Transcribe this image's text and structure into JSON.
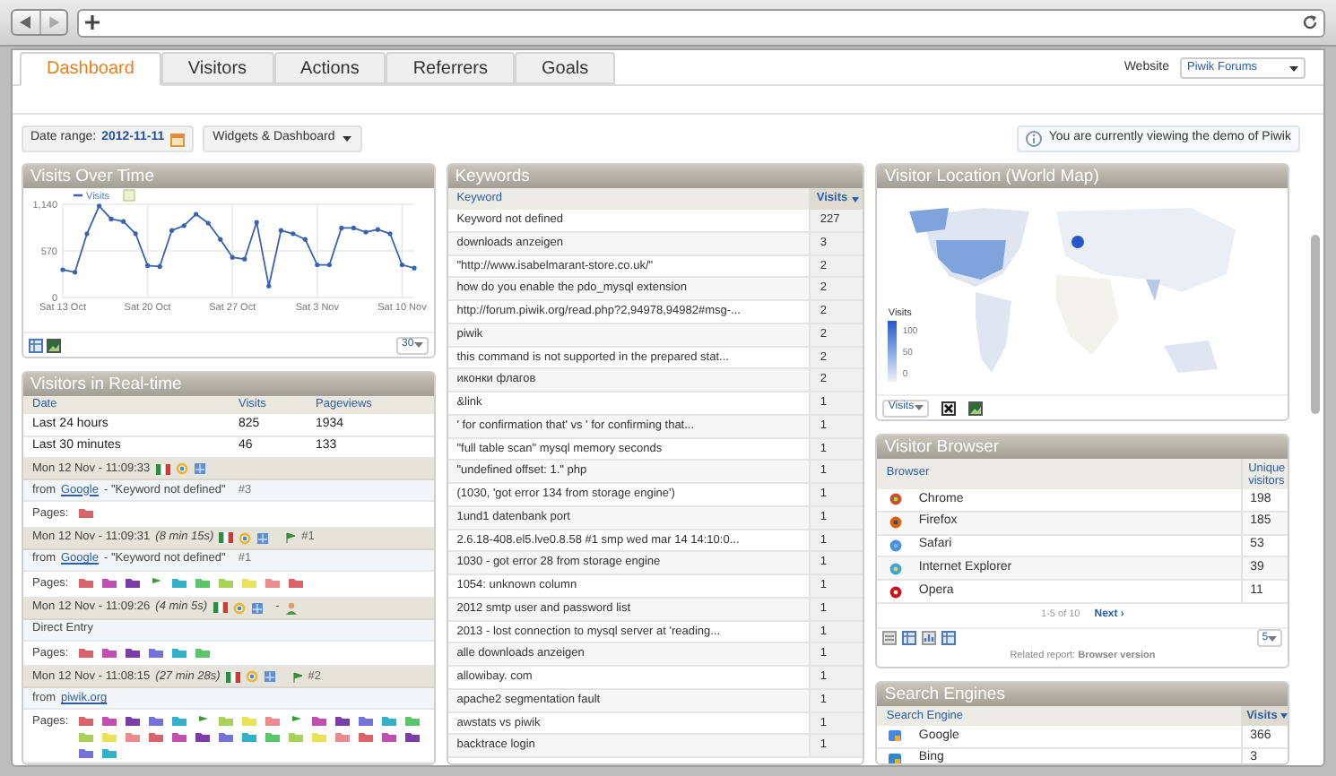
{
  "tabs": [
    {
      "label": "Dashboard",
      "selected": true
    },
    {
      "label": "Visitors",
      "selected": false
    },
    {
      "label": "Actions",
      "selected": false
    },
    {
      "label": "Referrers",
      "selected": false
    },
    {
      "label": "Goals",
      "selected": false
    }
  ],
  "website": {
    "label": "Website",
    "value": "Piwik Forums"
  },
  "toolbar": {
    "date_label": "Date range:",
    "date_value": "2012-11-11",
    "widgets_button": "Widgets & Dashboard",
    "notice": "You are currently viewing the demo of Piwik"
  },
  "visits_over_time": {
    "title": "Visits Over Time",
    "period_select": "30",
    "chart_data": {
      "type": "line",
      "ylim": [
        0,
        1140
      ],
      "grid": true,
      "categories": [
        "Sat 13 Oct",
        null,
        null,
        null,
        null,
        null,
        null,
        "Sat 20 Oct",
        null,
        null,
        null,
        null,
        null,
        null,
        "Sat 27 Oct",
        null,
        null,
        null,
        null,
        null,
        null,
        "Sat 3 Nov",
        null,
        null,
        null,
        null,
        null,
        null,
        "Sat 10 Nov",
        null
      ],
      "yticks": [
        {
          "value": 0,
          "label": "0"
        },
        {
          "value": 570,
          "label": "570"
        },
        {
          "value": 1140,
          "label": "1,140"
        }
      ],
      "series": [
        {
          "name": "Visits",
          "color": "#3a62ad",
          "values": [
            340,
            310,
            780,
            1120,
            960,
            930,
            780,
            390,
            380,
            820,
            880,
            1020,
            910,
            710,
            490,
            470,
            920,
            140,
            820,
            780,
            710,
            400,
            400,
            850,
            850,
            800,
            830,
            780,
            400,
            360
          ]
        }
      ]
    }
  },
  "realtime": {
    "title": "Visitors in Real-time",
    "columns": [
      "Date",
      "Visits",
      "Pageviews"
    ],
    "rows": [
      [
        "Last 24 hours",
        "825",
        "1934"
      ],
      [
        "Last 30 minutes",
        "46",
        "133"
      ]
    ],
    "visits": [
      {
        "time": "Mon 12 Nov - 11:09:33",
        "referrer": {
          "kind": "search",
          "prefix": "from",
          "link": "Google",
          "keyword": "- \"Keyword not defined\"",
          "rank": "#3"
        },
        "pages_label": "Pages:",
        "pages": [
          {
            "kind": "folder",
            "color": "#d9636b"
          }
        ]
      },
      {
        "time": "Mon 12 Nov - 11:09:31",
        "duration": "(8 min 15s)",
        "goals": "#1",
        "referrer": {
          "kind": "search",
          "prefix": "from",
          "link": "Google",
          "keyword": "- \"Keyword not defined\"",
          "rank": "#1"
        },
        "pages_label": "Pages:",
        "pages": [
          {
            "kind": "folder",
            "color": "#d9636b"
          },
          {
            "kind": "folder",
            "color": "#c04fb0"
          },
          {
            "kind": "folder",
            "color": "#7a3ea8"
          },
          {
            "kind": "flag",
            "color": "#3a9a3a"
          },
          {
            "kind": "folder",
            "color": "#34b0c8"
          },
          {
            "kind": "folder",
            "color": "#5cc46a"
          },
          {
            "kind": "folder",
            "color": "#a8d25a"
          },
          {
            "kind": "folder",
            "color": "#e8e35a"
          },
          {
            "kind": "folder",
            "color": "#ec8a90"
          },
          {
            "kind": "folder",
            "color": "#d9636b"
          }
        ]
      },
      {
        "time": "Mon 12 Nov - 11:09:26",
        "duration": "(4 min 5s)",
        "extra": "-",
        "referrer": {
          "kind": "direct",
          "text": "Direct Entry"
        },
        "pages_label": "Pages:",
        "pages": [
          {
            "kind": "folder",
            "color": "#d9636b"
          },
          {
            "kind": "folder",
            "color": "#c04fb0"
          },
          {
            "kind": "folder",
            "color": "#7a3ea8"
          },
          {
            "kind": "folder",
            "color": "#7474d8"
          },
          {
            "kind": "folder",
            "color": "#34b0c8"
          },
          {
            "kind": "folder",
            "color": "#5cc46a"
          }
        ]
      },
      {
        "time": "Mon 12 Nov - 11:08:15",
        "duration": "(27 min 28s)",
        "goals": "#2",
        "referrer": {
          "kind": "website",
          "prefix": "from",
          "link": "piwik.org"
        },
        "pages_label": "Pages:",
        "pages": [
          {
            "kind": "folder",
            "color": "#d9636b"
          },
          {
            "kind": "folder",
            "color": "#c04fb0"
          },
          {
            "kind": "folder",
            "color": "#7a3ea8"
          },
          {
            "kind": "folder",
            "color": "#7474d8"
          },
          {
            "kind": "folder",
            "color": "#34b0c8"
          },
          {
            "kind": "flag",
            "color": "#3a9a3a"
          },
          {
            "kind": "folder",
            "color": "#a8d25a"
          },
          {
            "kind": "folder",
            "color": "#e8e35a"
          },
          {
            "kind": "folder",
            "color": "#ec8a90"
          },
          {
            "kind": "flag",
            "color": "#3a9a3a"
          },
          {
            "kind": "folder",
            "color": "#c04fb0"
          },
          {
            "kind": "folder",
            "color": "#7a3ea8"
          },
          {
            "kind": "folder",
            "color": "#7474d8"
          },
          {
            "kind": "folder",
            "color": "#34b0c8"
          },
          {
            "kind": "folder",
            "color": "#5cc46a"
          },
          {
            "kind": "folder",
            "color": "#a8d25a"
          },
          {
            "kind": "folder",
            "color": "#e8e35a"
          },
          {
            "kind": "folder",
            "color": "#ec8a90"
          },
          {
            "kind": "folder",
            "color": "#d9636b"
          },
          {
            "kind": "folder",
            "color": "#c04fb0"
          },
          {
            "kind": "folder",
            "color": "#7a3ea8"
          },
          {
            "kind": "folder",
            "color": "#7474d8"
          },
          {
            "kind": "folder",
            "color": "#34b0c8"
          },
          {
            "kind": "folder",
            "color": "#5cc46a"
          },
          {
            "kind": "folder",
            "color": "#a8d25a"
          },
          {
            "kind": "folder",
            "color": "#e8e35a"
          },
          {
            "kind": "folder",
            "color": "#ec8a90"
          },
          {
            "kind": "folder",
            "color": "#d9636b"
          },
          {
            "kind": "folder",
            "color": "#c04fb0"
          },
          {
            "kind": "folder",
            "color": "#7a3ea8"
          },
          {
            "kind": "folder",
            "color": "#7474d8"
          },
          {
            "kind": "folder",
            "color": "#34b0c8"
          }
        ]
      }
    ]
  },
  "keywords": {
    "title": "Keywords",
    "columns": [
      "Keyword",
      "Visits"
    ],
    "rows": [
      [
        "Keyword not defined",
        "227"
      ],
      [
        "downloads anzeigen",
        "3"
      ],
      [
        "\"http://www.isabelmarant-store.co.uk/\"",
        "2"
      ],
      [
        "how do you enable the pdo_mysql extension",
        "2"
      ],
      [
        "http://forum.piwik.org/read.php?2,94978,94982#msg-...",
        "2"
      ],
      [
        "piwik",
        "2"
      ],
      [
        "this command is not supported in the prepared stat...",
        "2"
      ],
      [
        "иконки флагов",
        "2"
      ],
      [
        "&link",
        "1"
      ],
      [
        "' for confirmation that' vs ' for confirming that...",
        "1"
      ],
      [
        "\"full table scan\" mysql memory seconds",
        "1"
      ],
      [
        "\"undefined offset: 1.\" php",
        "1"
      ],
      [
        "(1030, 'got error 134 from storage engine')",
        "1"
      ],
      [
        "1und1 datenbank port",
        "1"
      ],
      [
        "2.6.18-408.el5.lve0.8.58 #1 smp wed mar 14 14:10:0...",
        "1"
      ],
      [
        "1030 - got error 28 from storage engine",
        "1"
      ],
      [
        "1054: unknown column",
        "1"
      ],
      [
        "2012 smtp user and password list",
        "1"
      ],
      [
        "2013 - lost connection to mysql server at 'reading...",
        "1"
      ],
      [
        "alle downloads anzeigen",
        "1"
      ],
      [
        "allowibay. com",
        "1"
      ],
      [
        "apache2 segmentation fault",
        "1"
      ],
      [
        "awstats vs piwik",
        "1"
      ],
      [
        "backtrace login",
        "1"
      ]
    ]
  },
  "visitor_location": {
    "title": "Visitor Location (World Map)",
    "legend_title": "Visits",
    "legend_labels": [
      "100",
      "50",
      "0"
    ],
    "metric_select": "Visits"
  },
  "visitor_browser": {
    "title": "Visitor Browser",
    "columns": [
      "Browser",
      "Unique visitors"
    ],
    "rows": [
      [
        "Chrome",
        "198"
      ],
      [
        "Firefox",
        "185"
      ],
      [
        "Safari",
        "53"
      ],
      [
        "Internet Explorer",
        "39"
      ],
      [
        "Opera",
        "11"
      ]
    ],
    "pagination": "1-5 of 10",
    "next": "Next ›",
    "limit_select": "5",
    "related": "Related report: **Browser version**"
  },
  "search_engines": {
    "title": "Search Engines",
    "columns": [
      "Search Engine",
      "Visits"
    ],
    "rows": [
      [
        "Google",
        "366"
      ],
      [
        "Bing",
        "3"
      ]
    ]
  }
}
